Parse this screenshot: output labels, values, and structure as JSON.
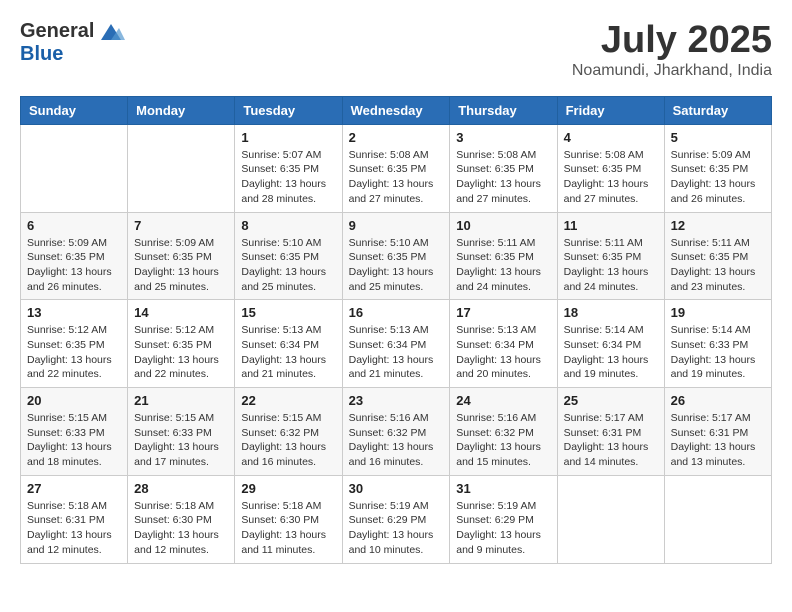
{
  "header": {
    "logo_general": "General",
    "logo_blue": "Blue",
    "title": "July 2025",
    "location": "Noamundi, Jharkhand, India"
  },
  "weekdays": [
    "Sunday",
    "Monday",
    "Tuesday",
    "Wednesday",
    "Thursday",
    "Friday",
    "Saturday"
  ],
  "weeks": [
    [
      {
        "day": "",
        "info": ""
      },
      {
        "day": "",
        "info": ""
      },
      {
        "day": "1",
        "info": "Sunrise: 5:07 AM\nSunset: 6:35 PM\nDaylight: 13 hours and 28 minutes."
      },
      {
        "day": "2",
        "info": "Sunrise: 5:08 AM\nSunset: 6:35 PM\nDaylight: 13 hours and 27 minutes."
      },
      {
        "day": "3",
        "info": "Sunrise: 5:08 AM\nSunset: 6:35 PM\nDaylight: 13 hours and 27 minutes."
      },
      {
        "day": "4",
        "info": "Sunrise: 5:08 AM\nSunset: 6:35 PM\nDaylight: 13 hours and 27 minutes."
      },
      {
        "day": "5",
        "info": "Sunrise: 5:09 AM\nSunset: 6:35 PM\nDaylight: 13 hours and 26 minutes."
      }
    ],
    [
      {
        "day": "6",
        "info": "Sunrise: 5:09 AM\nSunset: 6:35 PM\nDaylight: 13 hours and 26 minutes."
      },
      {
        "day": "7",
        "info": "Sunrise: 5:09 AM\nSunset: 6:35 PM\nDaylight: 13 hours and 25 minutes."
      },
      {
        "day": "8",
        "info": "Sunrise: 5:10 AM\nSunset: 6:35 PM\nDaylight: 13 hours and 25 minutes."
      },
      {
        "day": "9",
        "info": "Sunrise: 5:10 AM\nSunset: 6:35 PM\nDaylight: 13 hours and 25 minutes."
      },
      {
        "day": "10",
        "info": "Sunrise: 5:11 AM\nSunset: 6:35 PM\nDaylight: 13 hours and 24 minutes."
      },
      {
        "day": "11",
        "info": "Sunrise: 5:11 AM\nSunset: 6:35 PM\nDaylight: 13 hours and 24 minutes."
      },
      {
        "day": "12",
        "info": "Sunrise: 5:11 AM\nSunset: 6:35 PM\nDaylight: 13 hours and 23 minutes."
      }
    ],
    [
      {
        "day": "13",
        "info": "Sunrise: 5:12 AM\nSunset: 6:35 PM\nDaylight: 13 hours and 22 minutes."
      },
      {
        "day": "14",
        "info": "Sunrise: 5:12 AM\nSunset: 6:35 PM\nDaylight: 13 hours and 22 minutes."
      },
      {
        "day": "15",
        "info": "Sunrise: 5:13 AM\nSunset: 6:34 PM\nDaylight: 13 hours and 21 minutes."
      },
      {
        "day": "16",
        "info": "Sunrise: 5:13 AM\nSunset: 6:34 PM\nDaylight: 13 hours and 21 minutes."
      },
      {
        "day": "17",
        "info": "Sunrise: 5:13 AM\nSunset: 6:34 PM\nDaylight: 13 hours and 20 minutes."
      },
      {
        "day": "18",
        "info": "Sunrise: 5:14 AM\nSunset: 6:34 PM\nDaylight: 13 hours and 19 minutes."
      },
      {
        "day": "19",
        "info": "Sunrise: 5:14 AM\nSunset: 6:33 PM\nDaylight: 13 hours and 19 minutes."
      }
    ],
    [
      {
        "day": "20",
        "info": "Sunrise: 5:15 AM\nSunset: 6:33 PM\nDaylight: 13 hours and 18 minutes."
      },
      {
        "day": "21",
        "info": "Sunrise: 5:15 AM\nSunset: 6:33 PM\nDaylight: 13 hours and 17 minutes."
      },
      {
        "day": "22",
        "info": "Sunrise: 5:15 AM\nSunset: 6:32 PM\nDaylight: 13 hours and 16 minutes."
      },
      {
        "day": "23",
        "info": "Sunrise: 5:16 AM\nSunset: 6:32 PM\nDaylight: 13 hours and 16 minutes."
      },
      {
        "day": "24",
        "info": "Sunrise: 5:16 AM\nSunset: 6:32 PM\nDaylight: 13 hours and 15 minutes."
      },
      {
        "day": "25",
        "info": "Sunrise: 5:17 AM\nSunset: 6:31 PM\nDaylight: 13 hours and 14 minutes."
      },
      {
        "day": "26",
        "info": "Sunrise: 5:17 AM\nSunset: 6:31 PM\nDaylight: 13 hours and 13 minutes."
      }
    ],
    [
      {
        "day": "27",
        "info": "Sunrise: 5:18 AM\nSunset: 6:31 PM\nDaylight: 13 hours and 12 minutes."
      },
      {
        "day": "28",
        "info": "Sunrise: 5:18 AM\nSunset: 6:30 PM\nDaylight: 13 hours and 12 minutes."
      },
      {
        "day": "29",
        "info": "Sunrise: 5:18 AM\nSunset: 6:30 PM\nDaylight: 13 hours and 11 minutes."
      },
      {
        "day": "30",
        "info": "Sunrise: 5:19 AM\nSunset: 6:29 PM\nDaylight: 13 hours and 10 minutes."
      },
      {
        "day": "31",
        "info": "Sunrise: 5:19 AM\nSunset: 6:29 PM\nDaylight: 13 hours and 9 minutes."
      },
      {
        "day": "",
        "info": ""
      },
      {
        "day": "",
        "info": ""
      }
    ]
  ]
}
